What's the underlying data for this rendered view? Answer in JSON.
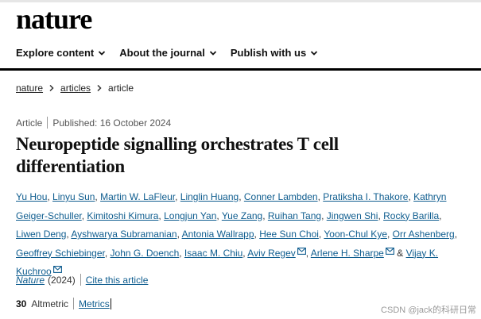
{
  "site": {
    "logo": "nature"
  },
  "nav": [
    {
      "label": "Explore content"
    },
    {
      "label": "About the journal"
    },
    {
      "label": "Publish with us"
    }
  ],
  "breadcrumb": {
    "items": [
      "nature",
      "articles"
    ],
    "current": "article"
  },
  "meta": {
    "type": "Article",
    "published": "Published: 16 October 2024"
  },
  "title": "Neuropeptide signalling orchestrates T cell differentiation",
  "authors": [
    {
      "name": "Yu Hou"
    },
    {
      "name": "Linyu Sun"
    },
    {
      "name": "Martin W. LaFleur"
    },
    {
      "name": "Linglin Huang"
    },
    {
      "name": "Conner Lambden"
    },
    {
      "name": "Pratiksha I. Thakore"
    },
    {
      "name": "Kathryn Geiger-Schuller"
    },
    {
      "name": "Kimitoshi Kimura"
    },
    {
      "name": "Longjun Yan"
    },
    {
      "name": "Yue Zang"
    },
    {
      "name": "Ruihan Tang"
    },
    {
      "name": "Jingwen Shi"
    },
    {
      "name": "Rocky Barilla"
    },
    {
      "name": "Liwen Deng"
    },
    {
      "name": "Ayshwarya Subramanian"
    },
    {
      "name": "Antonia Wallrapp"
    },
    {
      "name": "Hee Sun Choi"
    },
    {
      "name": "Yoon-Chul Kye"
    },
    {
      "name": "Orr Ashenberg"
    },
    {
      "name": "Geoffrey Schiebinger"
    },
    {
      "name": "John G. Doench"
    },
    {
      "name": "Isaac M. Chiu"
    },
    {
      "name": "Aviv Regev"
    },
    {
      "name": "Arlene H. Sharpe"
    },
    {
      "name": "Vijay K. Kuchroo"
    }
  ],
  "authors_ampersand": "&",
  "journal": {
    "name": "Nature",
    "year": "(2024)",
    "cite_label": "Cite this article"
  },
  "metrics": {
    "altmetric_count": "30",
    "altmetric_label": "Altmetric",
    "metrics_label": "Metrics"
  },
  "watermark": "CSDN @jack的科研日常",
  "colors": {
    "link": "#0f5d8f",
    "rule": "#000000"
  }
}
